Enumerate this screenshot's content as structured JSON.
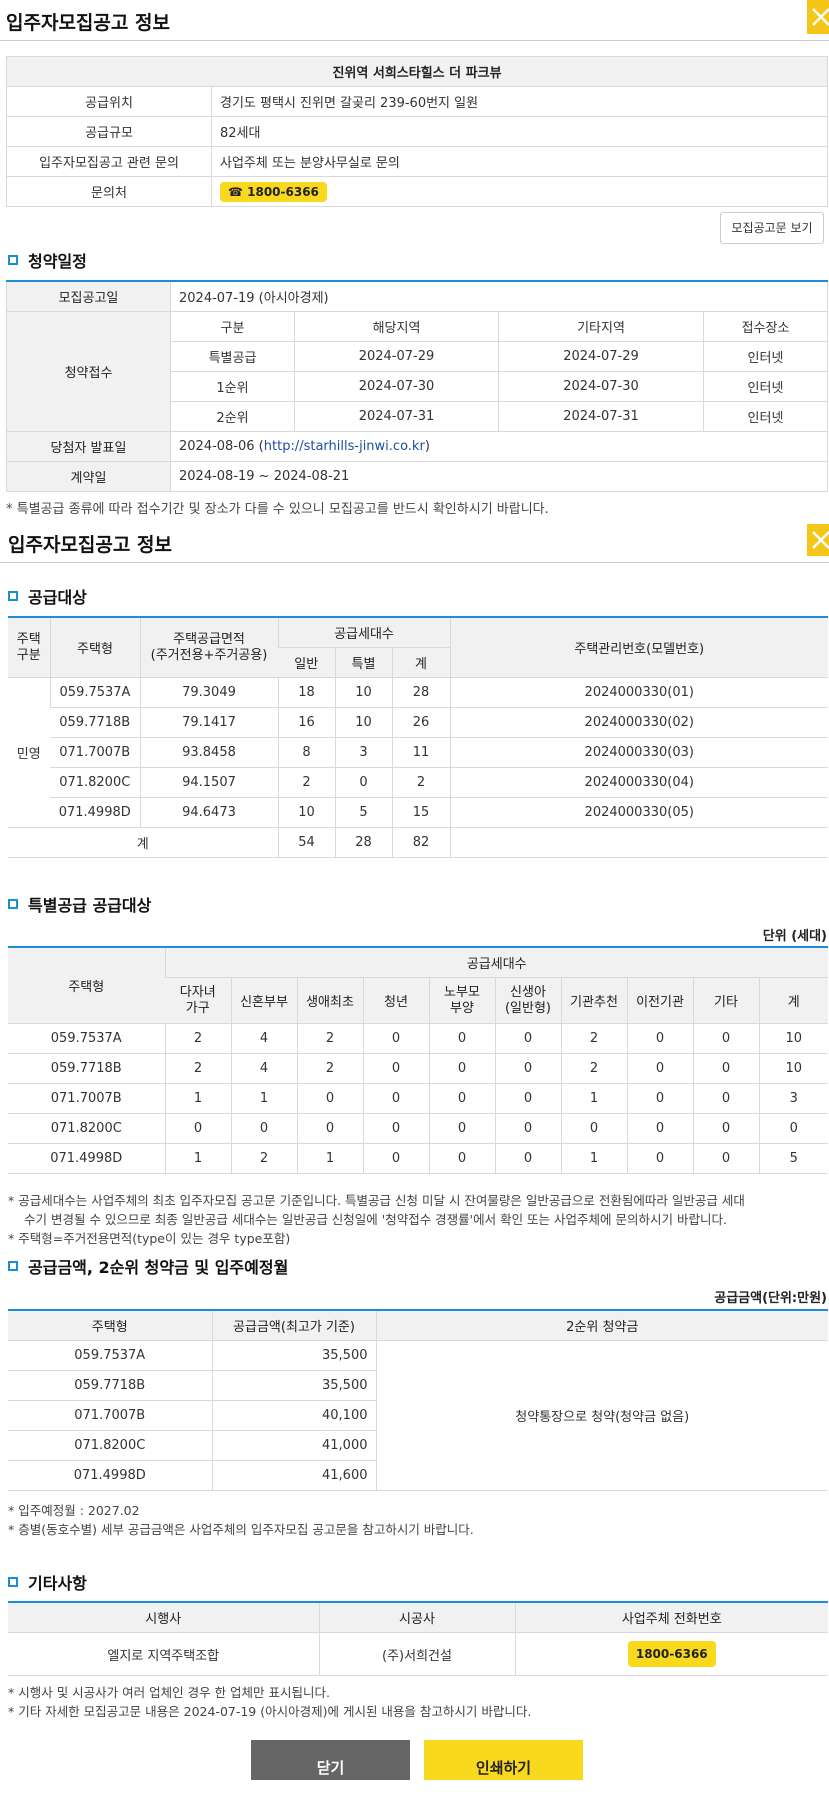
{
  "section1": {
    "title": "입주자모집공고 정보",
    "complex_name": "진위역 서희스타힐스 더 파크뷰",
    "rows": [
      {
        "label": "공급위치",
        "value": "경기도 평택시 진위면 갈곶리 239-60번지 일원"
      },
      {
        "label": "공급규모",
        "value": "82세대"
      },
      {
        "label": "입주자모집공고 관련 문의",
        "value": "사업주체 또는 분양사무실로 문의"
      }
    ],
    "contact_label": "문의처",
    "contact_phone": "☎ 1800-6366",
    "notice_button": "모집공고문 보기"
  },
  "schedule": {
    "heading": "청약일정",
    "announce_label": "모집공고일",
    "announce_value": "2024-07-19 (아시아경제)",
    "receipt_label": "청약접수",
    "headers": [
      "구분",
      "해당지역",
      "기타지역",
      "접수장소"
    ],
    "rows": [
      [
        "특별공급",
        "2024-07-29",
        "2024-07-29",
        "인터넷"
      ],
      [
        "1순위",
        "2024-07-30",
        "2024-07-30",
        "인터넷"
      ],
      [
        "2순위",
        "2024-07-31",
        "2024-07-31",
        "인터넷"
      ]
    ],
    "winner_label": "당첨자 발표일",
    "winner_date": "2024-08-06 (",
    "winner_url": "http://starhills-jinwi.co.kr",
    "winner_close": ")",
    "contract_label": "계약일",
    "contract_value": "2024-08-19 ~ 2024-08-21",
    "note": "* 특별공급 종류에 따라 접수기간 및 장소가 다를 수 있으니 모집공고를 반드시 확인하시기 바랍니다."
  },
  "section2": {
    "title": "입주자모집공고 정보"
  },
  "supply": {
    "heading": "공급대상",
    "h_type_group_1": "주택",
    "h_type_group_2": "구분",
    "h_type": "주택형",
    "h_area_1": "주택공급면적",
    "h_area_2": "(주거전용+주거공용)",
    "h_count": "공급세대수",
    "h_general": "일반",
    "h_special": "특별",
    "h_total": "계",
    "h_model": "주택관리번호(모델번호)",
    "group": "민영",
    "rows": [
      [
        "059.7537A",
        "79.3049",
        "18",
        "10",
        "28",
        "2024000330(01)"
      ],
      [
        "059.7718B",
        "79.1417",
        "16",
        "10",
        "26",
        "2024000330(02)"
      ],
      [
        "071.7007B",
        "93.8458",
        "8",
        "3",
        "11",
        "2024000330(03)"
      ],
      [
        "071.8200C",
        "94.1507",
        "2",
        "0",
        "2",
        "2024000330(04)"
      ],
      [
        "071.4998D",
        "94.6473",
        "10",
        "5",
        "15",
        "2024000330(05)"
      ]
    ],
    "sum_label": "계",
    "sum": [
      "54",
      "28",
      "82"
    ]
  },
  "special": {
    "heading": "특별공급 공급대상",
    "unit": "단위 (세대)",
    "h_type": "주택형",
    "h_count": "공급세대수",
    "cols": [
      [
        "다자녀",
        "가구"
      ],
      [
        "신혼부부"
      ],
      [
        "생애최초"
      ],
      [
        "청년"
      ],
      [
        "노부모",
        "부양"
      ],
      [
        "신생아",
        "(일반형)"
      ],
      [
        "기관추천"
      ],
      [
        "이전기관"
      ],
      [
        "기타"
      ],
      [
        "계"
      ]
    ],
    "rows": [
      [
        "059.7537A",
        "2",
        "4",
        "2",
        "0",
        "0",
        "0",
        "2",
        "0",
        "0",
        "10"
      ],
      [
        "059.7718B",
        "2",
        "4",
        "2",
        "0",
        "0",
        "0",
        "2",
        "0",
        "0",
        "10"
      ],
      [
        "071.7007B",
        "1",
        "1",
        "0",
        "0",
        "0",
        "0",
        "1",
        "0",
        "0",
        "3"
      ],
      [
        "071.8200C",
        "0",
        "0",
        "0",
        "0",
        "0",
        "0",
        "0",
        "0",
        "0",
        "0"
      ],
      [
        "071.4998D",
        "1",
        "2",
        "1",
        "0",
        "0",
        "0",
        "1",
        "0",
        "0",
        "5"
      ]
    ],
    "note1": "* 공급세대수는 사업주체의 최초 입주자모집 공고문 기준입니다. 특별공급 신청 미달 시 잔여물량은 일반공급으로 전환됨에따라 일반공급 세대",
    "note1b": "수기 변경될 수 있으므로 최종 일반공급 세대수는 일반공급 신청일에 '청약접수 경쟁률'에서 확인 또는 사업주체에 문의하시기 바랍니다.",
    "note2": "* 주택형=주거전용면적(type이 있는 경우 type포함)"
  },
  "price": {
    "heading": "공급금액, 2순위 청약금 및 입주예정월",
    "unit": "공급금액(단위:만원)",
    "h_type": "주택형",
    "h_price": "공급금액(최고가 기준)",
    "h_deposit": "2순위 청약금",
    "rows": [
      [
        "059.7537A",
        "35,500"
      ],
      [
        "059.7718B",
        "35,500"
      ],
      [
        "071.7007B",
        "40,100"
      ],
      [
        "071.8200C",
        "41,000"
      ],
      [
        "071.4998D",
        "41,600"
      ]
    ],
    "deposit_value": "청약통장으로 청약(청약금 없음)",
    "note1": "* 입주예정월 : 2027.02",
    "note2": "* 층별(동호수별) 세부 공급금액은 사업주체의 입주자모집 공고문을 참고하시기 바랍니다."
  },
  "etc": {
    "heading": "기타사항",
    "headers": [
      "시행사",
      "시공사",
      "사업주체 전화번호"
    ],
    "developer": "엘지로 지역주택조합",
    "builder": "(주)서희건설",
    "phone": "1800-6366",
    "note1": "* 시행사 및 시공사가 여러 업체인 경우 한 업체만 표시됩니다.",
    "note2": "* 기타 자세한 모집공고문 내용은 2024-07-19 (아시아경제)에 게시된 내용을 참고하시기 바랍니다."
  },
  "footer": {
    "close_button": "닫기",
    "print_button": "인쇄하기"
  },
  "colors": {
    "accent_blue": "#1a8fd6",
    "highlight_yellow": "#f9d91d",
    "close_dark": "#666666"
  }
}
